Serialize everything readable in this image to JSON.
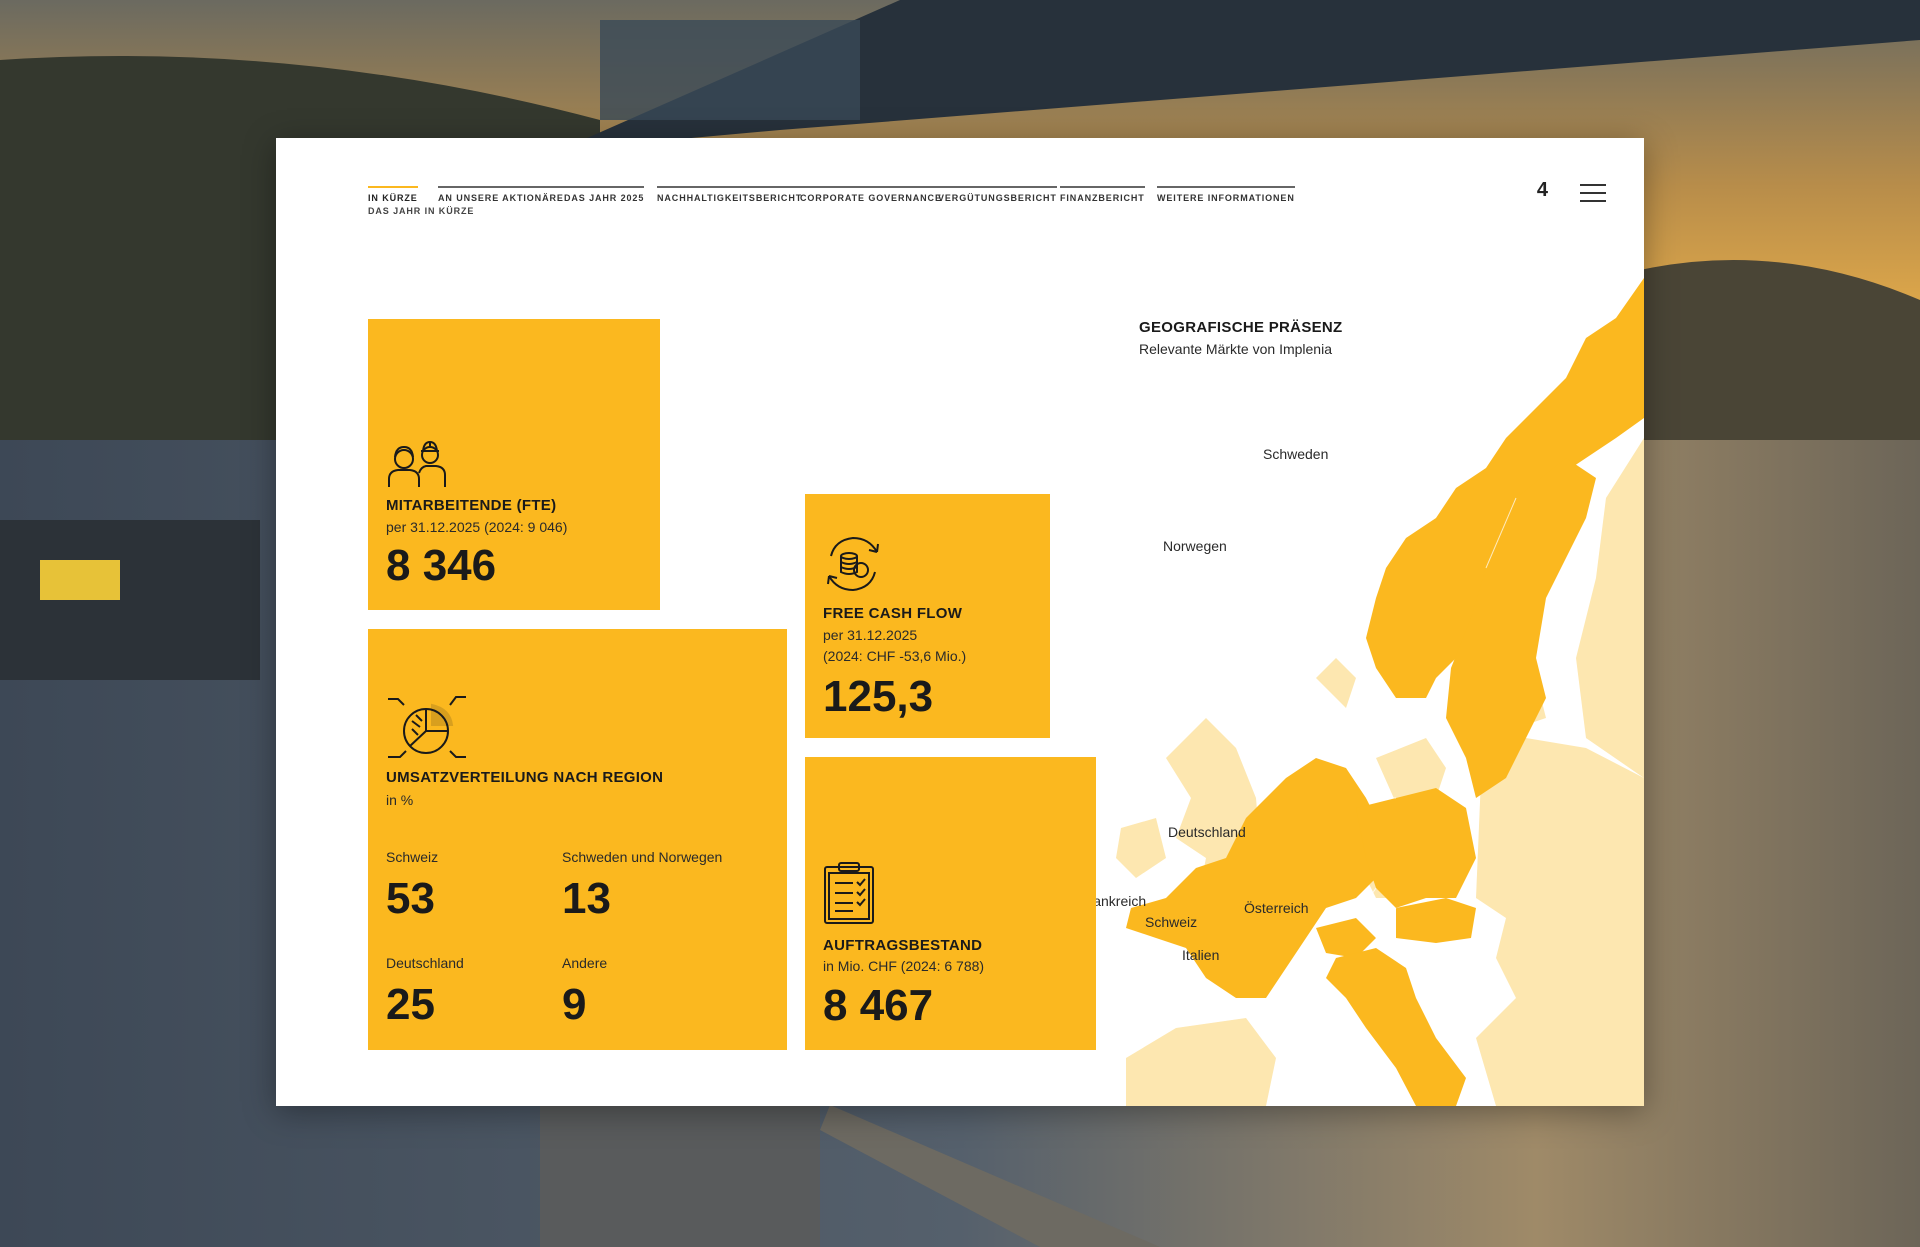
{
  "nav": {
    "items": [
      {
        "label": "In Kürze",
        "active": true
      },
      {
        "label": "An unsere Aktionäre",
        "active": false
      },
      {
        "label": "Das Jahr 2025",
        "active": false
      },
      {
        "label": "Nachhaltigkeitsbericht",
        "active": false
      },
      {
        "label": "Corporate Governance",
        "active": false
      },
      {
        "label": "Vergütungsbericht",
        "active": false
      },
      {
        "label": "Finanzbericht",
        "active": false
      },
      {
        "label": "Weitere Informationen",
        "active": false
      }
    ],
    "sub_item": "Das Jahr in Kürze",
    "page_number": "4",
    "menu_icon": "hamburger-menu-icon"
  },
  "tiles": {
    "employees": {
      "icon": "workers-icon",
      "title": "Mitarbeitende (FTE)",
      "subtitle": "per 31.12.2025 (2024: 9 046)",
      "value": "8 346"
    },
    "cashflow": {
      "icon": "cash-cycle-icon",
      "title": "Free Cash Flow",
      "subtitle_1": "per 31.12.2025",
      "subtitle_2": "(2024: CHF -53,6 Mio.)",
      "value": "125,3"
    },
    "revenue": {
      "icon": "pie-chart-icon",
      "title": "Umsatzverteilung nach Region",
      "subtitle": "in %",
      "regions": [
        {
          "label": "Schweiz",
          "value": "53"
        },
        {
          "label": "Schweden und Norwegen",
          "value": "13"
        },
        {
          "label": "Deutschland",
          "value": "25"
        },
        {
          "label": "Andere",
          "value": "9"
        }
      ]
    },
    "backlog": {
      "icon": "clipboard-checklist-icon",
      "title": "Auftragsbestand",
      "subtitle": "in Mio. CHF (2024: 6 788)",
      "value": "8 467"
    }
  },
  "map": {
    "title": "GEOGRAFISCHE PRÄSENZ",
    "subtitle": "Relevante Märkte von Implenia",
    "labels": [
      "Schweden",
      "Norwegen",
      "Deutschland",
      "Frankreich",
      "Schweiz",
      "Österreich",
      "Italien"
    ],
    "colors": {
      "relevant": "#FBB81F",
      "other": "#FDE7B0"
    }
  },
  "colors": {
    "accent": "#FBB81F",
    "card": "#FFFFFF"
  }
}
